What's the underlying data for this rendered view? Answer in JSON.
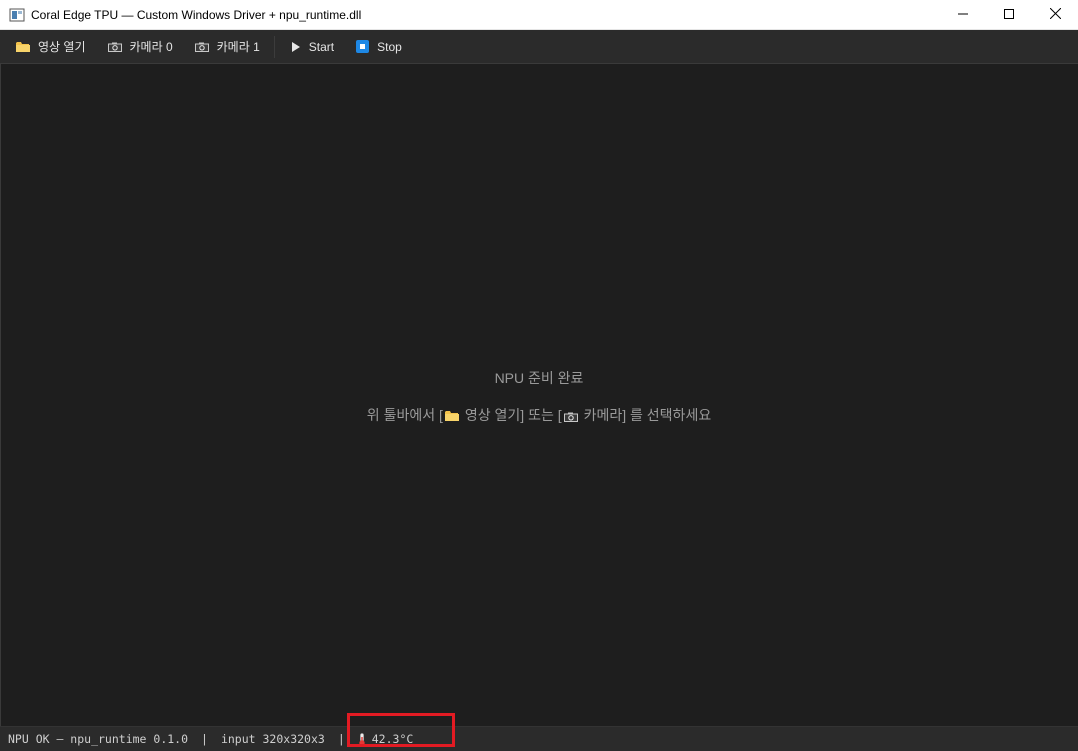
{
  "window": {
    "title": "Coral Edge TPU — Custom Windows Driver + npu_runtime.dll",
    "app_icon": "window-app-icon",
    "controls": [
      "minimize-icon",
      "maximize-icon",
      "close-icon"
    ]
  },
  "toolbar": {
    "open_video": {
      "label": "영상 열기",
      "icon": "folder-icon"
    },
    "camera0": {
      "label": "카메라 0",
      "icon": "camera-icon"
    },
    "camera1": {
      "label": "카메라 1",
      "icon": "camera-icon"
    },
    "start": {
      "label": "Start",
      "icon": "play-icon"
    },
    "stop": {
      "label": "Stop",
      "icon": "stop-icon"
    }
  },
  "main": {
    "ready_text": "NPU 준비 완료",
    "hint_prefix": "위 툴바에서 [",
    "hint_open": "영상 열기] 또는 [",
    "hint_camera": "카메라] 를 선택하세요"
  },
  "status": {
    "npu_status": "NPU OK — npu_runtime 0.1.0",
    "separator": "|",
    "input": "input 320x320x3",
    "temperature": "42.3°C",
    "temperature_icon": "thermometer-icon",
    "highlight_color": "#e31b23"
  },
  "colors": {
    "background": "#1e1e1e",
    "toolbar": "#2b2b2b",
    "folder": "#f3c24b",
    "stop_accent": "#1e88e5"
  }
}
